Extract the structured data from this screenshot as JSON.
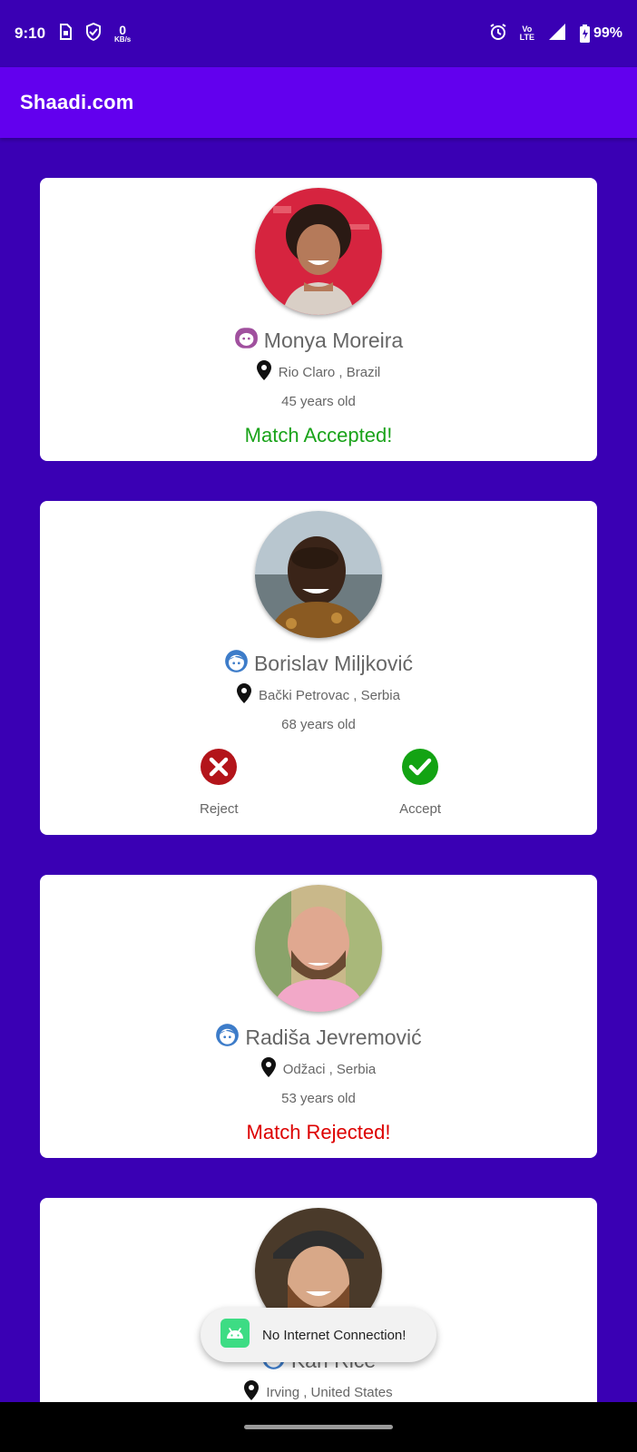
{
  "status_bar": {
    "time": "9:10",
    "net_speed_value": "0",
    "net_speed_unit": "KB/s",
    "lte_label_top": "Vo",
    "lte_label_bottom": "LTE",
    "battery": "99%"
  },
  "app_bar": {
    "title": "Shaadi.com"
  },
  "profiles": [
    {
      "name": "Monya Moreira",
      "gender": "female",
      "gender_icon": "female-face-icon",
      "location": "Rio Claro , Brazil",
      "age": "45 years old",
      "status": "Match Accepted!"
    },
    {
      "name": "Borislav Miljković",
      "gender": "male",
      "gender_icon": "male-face-icon",
      "location": "Bački Petrovac , Serbia",
      "age": "68 years old",
      "reject_label": "Reject",
      "accept_label": "Accept"
    },
    {
      "name": "Radiša Jevremović",
      "gender": "male",
      "gender_icon": "male-face-icon",
      "location": "Odžaci , Serbia",
      "age": "53 years old",
      "status": "Match Rejected!"
    },
    {
      "name": "Kari Rice",
      "gender": "male",
      "gender_icon": "male-face-icon",
      "location": "Irving , United States"
    }
  ],
  "toast": {
    "text": "No Internet Connection!",
    "icon": "android-icon"
  },
  "colors": {
    "background": "#3a00b4",
    "app_bar": "#6200ee",
    "accepted": "#1aa31a",
    "rejected": "#dd0000",
    "female_icon": "#a0509e",
    "male_icon": "#3d7cc9"
  }
}
